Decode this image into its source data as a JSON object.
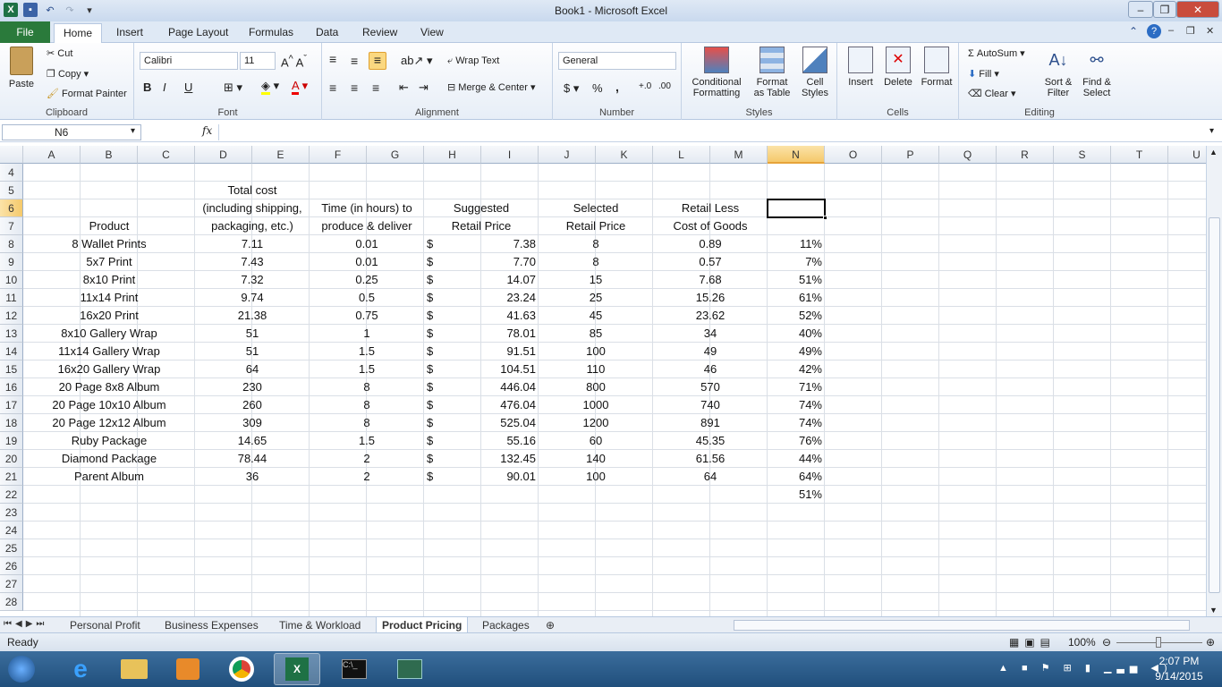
{
  "window": {
    "title": "Book1  -  Microsoft Excel",
    "close_glyph": "✕",
    "min_glyph": "–",
    "max_glyph": "❐"
  },
  "ribbon_tabs": [
    "File",
    "Home",
    "Insert",
    "Page Layout",
    "Formulas",
    "Data",
    "Review",
    "View"
  ],
  "clipboard": {
    "paste": "Paste",
    "cut": "Cut",
    "copy": "Copy",
    "format_painter": "Format Painter",
    "label": "Clipboard"
  },
  "font": {
    "name": "Calibri",
    "size": "11",
    "bold": "B",
    "italic": "I",
    "underline": "U",
    "label": "Font"
  },
  "alignment": {
    "wrap_text": "Wrap Text",
    "merge_center": "Merge & Center",
    "label": "Alignment"
  },
  "number": {
    "format": "General",
    "currency": "$",
    "percent": "%",
    "comma": ",",
    "label": "Number"
  },
  "styles": {
    "conditional": "Conditional",
    "conditional2": "Formatting",
    "format_as": "Format",
    "format_as2": "as Table",
    "cell": "Cell",
    "cell2": "Styles",
    "label": "Styles"
  },
  "cells": {
    "insert": "Insert",
    "delete": "Delete",
    "format": "Format",
    "label": "Cells"
  },
  "editing": {
    "autosum": "AutoSum",
    "fill": "Fill",
    "clear": "Clear",
    "sort": "Sort &",
    "sort2": "Filter",
    "find": "Find &",
    "find2": "Select",
    "label": "Editing"
  },
  "formula_bar": {
    "name_box": "N6",
    "fx": "fx",
    "formula": ""
  },
  "columns": [
    "A",
    "B",
    "C",
    "D",
    "E",
    "F",
    "G",
    "H",
    "I",
    "J",
    "K",
    "L",
    "M",
    "N",
    "O",
    "P",
    "Q",
    "R",
    "S",
    "T",
    "U"
  ],
  "rows": [
    "4",
    "5",
    "6",
    "7",
    "8",
    "9",
    "10",
    "11",
    "12",
    "13",
    "14",
    "15",
    "16",
    "17",
    "18",
    "19",
    "20",
    "21",
    "22",
    "23",
    "24",
    "25",
    "26",
    "27",
    "28"
  ],
  "headers": {
    "d5": "Total cost",
    "d6": "(including shipping,",
    "d7": "packaging, etc.)",
    "f6": "Time (in hours) to",
    "f7": "produce & deliver",
    "h6": "Suggested",
    "h7": "Retail Price",
    "j6": "Selected",
    "j7": "Retail Price",
    "l6": "Retail Less",
    "l7": "Cost of Goods",
    "b7": "Product"
  },
  "table": [
    {
      "product": "8 Wallet Prints",
      "cost": "7.11",
      "time": "0.01",
      "dollar": "$",
      "suggested": "7.38",
      "selected": "8",
      "less": "0.89",
      "pct": "11%"
    },
    {
      "product": "5x7 Print",
      "cost": "7.43",
      "time": "0.01",
      "dollar": "$",
      "suggested": "7.70",
      "selected": "8",
      "less": "0.57",
      "pct": "7%"
    },
    {
      "product": "8x10 Print",
      "cost": "7.32",
      "time": "0.25",
      "dollar": "$",
      "suggested": "14.07",
      "selected": "15",
      "less": "7.68",
      "pct": "51%"
    },
    {
      "product": "11x14 Print",
      "cost": "9.74",
      "time": "0.5",
      "dollar": "$",
      "suggested": "23.24",
      "selected": "25",
      "less": "15.26",
      "pct": "61%"
    },
    {
      "product": "16x20 Print",
      "cost": "21.38",
      "time": "0.75",
      "dollar": "$",
      "suggested": "41.63",
      "selected": "45",
      "less": "23.62",
      "pct": "52%"
    },
    {
      "product": "8x10 Gallery Wrap",
      "cost": "51",
      "time": "1",
      "dollar": "$",
      "suggested": "78.01",
      "selected": "85",
      "less": "34",
      "pct": "40%"
    },
    {
      "product": "11x14 Gallery Wrap",
      "cost": "51",
      "time": "1.5",
      "dollar": "$",
      "suggested": "91.51",
      "selected": "100",
      "less": "49",
      "pct": "49%"
    },
    {
      "product": "16x20 Gallery Wrap",
      "cost": "64",
      "time": "1.5",
      "dollar": "$",
      "suggested": "104.51",
      "selected": "110",
      "less": "46",
      "pct": "42%"
    },
    {
      "product": "20 Page 8x8 Album",
      "cost": "230",
      "time": "8",
      "dollar": "$",
      "suggested": "446.04",
      "selected": "800",
      "less": "570",
      "pct": "71%"
    },
    {
      "product": "20 Page 10x10 Album",
      "cost": "260",
      "time": "8",
      "dollar": "$",
      "suggested": "476.04",
      "selected": "1000",
      "less": "740",
      "pct": "74%"
    },
    {
      "product": "20 Page 12x12 Album",
      "cost": "309",
      "time": "8",
      "dollar": "$",
      "suggested": "525.04",
      "selected": "1200",
      "less": "891",
      "pct": "74%"
    },
    {
      "product": "Ruby Package",
      "cost": "14.65",
      "time": "1.5",
      "dollar": "$",
      "suggested": "55.16",
      "selected": "60",
      "less": "45.35",
      "pct": "76%"
    },
    {
      "product": "Diamond Package",
      "cost": "78.44",
      "time": "2",
      "dollar": "$",
      "suggested": "132.45",
      "selected": "140",
      "less": "61.56",
      "pct": "44%"
    },
    {
      "product": "Parent Album",
      "cost": "36",
      "time": "2",
      "dollar": "$",
      "suggested": "90.01",
      "selected": "100",
      "less": "64",
      "pct": "64%"
    }
  ],
  "n22": "51%",
  "sheet_tabs": [
    "Personal Profit",
    "Business Expenses",
    "Time & Workload",
    "Product Pricing",
    "Packages"
  ],
  "active_sheet": "Product Pricing",
  "status": {
    "ready": "Ready",
    "zoom": "100%"
  },
  "clock": {
    "time": "2:07 PM",
    "date": "9/14/2015"
  },
  "colors": {
    "file_tab": "#2a7a3b",
    "selection": "#000000",
    "taskbar": "#204f7c"
  }
}
